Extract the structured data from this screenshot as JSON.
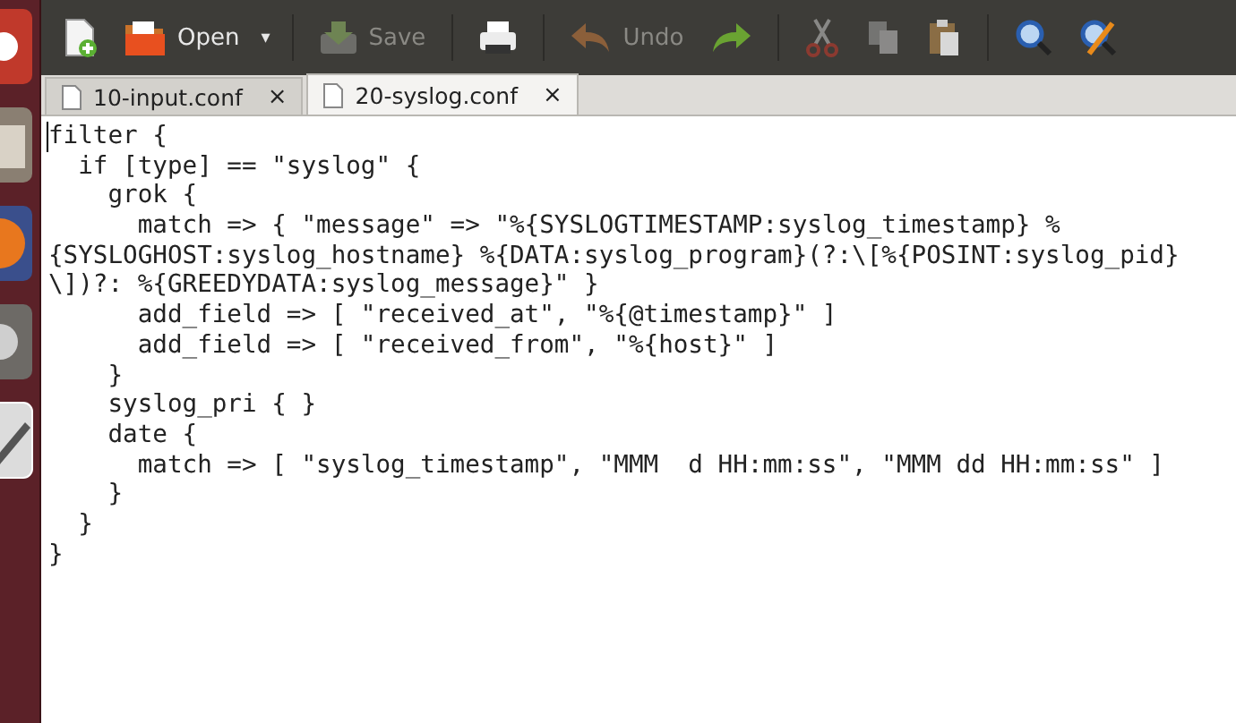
{
  "toolbar": [
    {
      "kind": "new",
      "disabled": false
    },
    {
      "kind": "open",
      "label": "Open",
      "disabled": false
    },
    {
      "kind": "dropdown",
      "label": "▾",
      "disabled": false
    },
    {
      "kind": "sep"
    },
    {
      "kind": "save",
      "label": "Save",
      "disabled": true
    },
    {
      "kind": "sep"
    },
    {
      "kind": "print",
      "disabled": false
    },
    {
      "kind": "sep"
    },
    {
      "kind": "undo",
      "label": "Undo",
      "disabled": true
    },
    {
      "kind": "redo",
      "disabled": false
    },
    {
      "kind": "sep"
    },
    {
      "kind": "cut",
      "disabled": true
    },
    {
      "kind": "copy",
      "disabled": true
    },
    {
      "kind": "paste",
      "disabled": false
    },
    {
      "kind": "sep"
    },
    {
      "kind": "find",
      "disabled": false
    },
    {
      "kind": "replace",
      "disabled": false
    }
  ],
  "tabs": [
    {
      "label": "10-input.conf",
      "close": "×",
      "selected": false
    },
    {
      "label": "20-syslog.conf",
      "close": "×",
      "selected": true
    }
  ],
  "editor": {
    "lines": [
      "filter {",
      "  if [type] == \"syslog\" {",
      "    grok {",
      "      match => { \"message\" => \"%{SYSLOGTIMESTAMP:syslog_timestamp} %",
      "{SYSLOGHOST:syslog_hostname} %{DATA:syslog_program}(?:\\[%{POSINT:syslog_pid}",
      "\\])?: %{GREEDYDATA:syslog_message}\" }",
      "      add_field => [ \"received_at\", \"%{@timestamp}\" ]",
      "      add_field => [ \"received_from\", \"%{host}\" ]",
      "    }",
      "    syslog_pri { }",
      "    date {",
      "      match => [ \"syslog_timestamp\", \"MMM  d HH:mm:ss\", \"MMM dd HH:mm:ss\" ]",
      "    }",
      "  }",
      "}"
    ]
  }
}
